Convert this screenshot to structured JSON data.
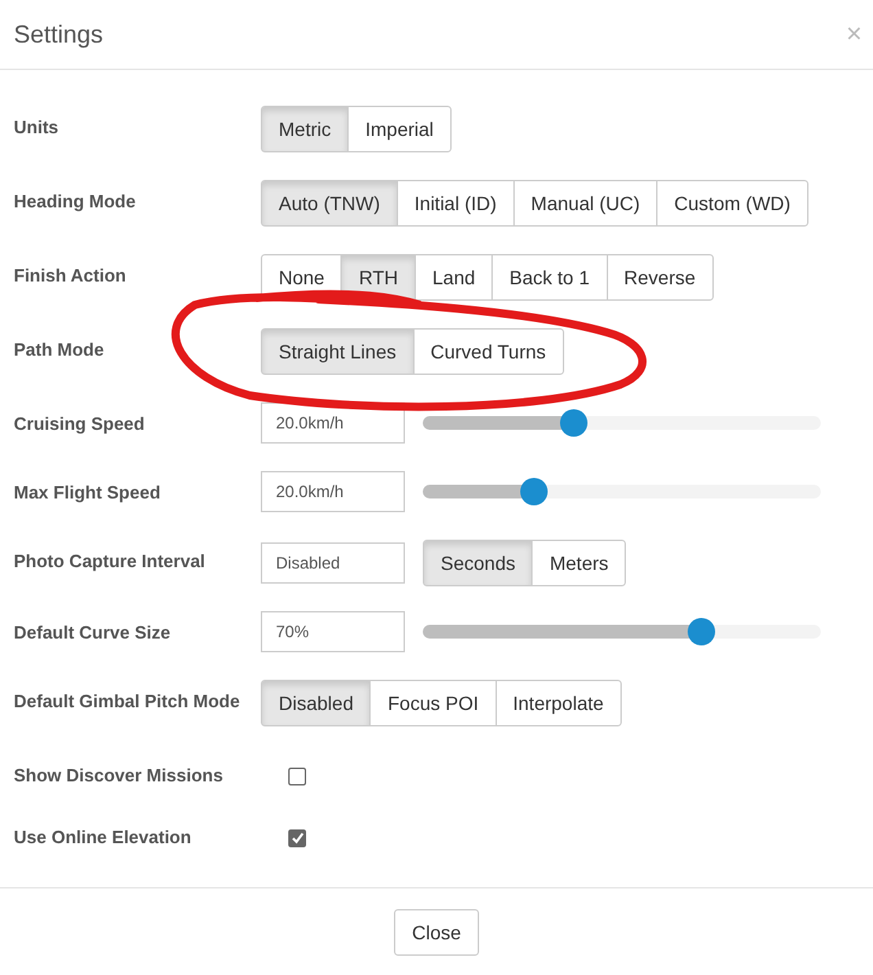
{
  "dialog": {
    "title": "Settings",
    "close_symbol": "×"
  },
  "rows": [
    {
      "kind": "segmented",
      "label": "Units",
      "options": [
        {
          "label": "Metric",
          "selected": true
        },
        {
          "label": "Imperial",
          "selected": false
        }
      ]
    },
    {
      "kind": "segmented",
      "label": "Heading Mode",
      "options": [
        {
          "label": "Auto (TNW)",
          "selected": true
        },
        {
          "label": "Initial (ID)",
          "selected": false
        },
        {
          "label": "Manual (UC)",
          "selected": false
        },
        {
          "label": "Custom (WD)",
          "selected": false
        }
      ]
    },
    {
      "kind": "segmented",
      "label": "Finish Action",
      "options": [
        {
          "label": "None",
          "selected": false
        },
        {
          "label": "RTH",
          "selected": true
        },
        {
          "label": "Land",
          "selected": false
        },
        {
          "label": "Back to 1",
          "selected": false
        },
        {
          "label": "Reverse",
          "selected": false
        }
      ]
    },
    {
      "kind": "segmented",
      "label": "Path Mode",
      "options": [
        {
          "label": "Straight Lines",
          "selected": true
        },
        {
          "label": "Curved Turns",
          "selected": false
        }
      ]
    },
    {
      "kind": "slider",
      "label": "Cruising Speed",
      "value": "20.0km/h",
      "level": 0.38
    },
    {
      "kind": "slider",
      "label": "Max Flight Speed",
      "value": "20.0km/h",
      "level": 0.28
    },
    {
      "kind": "input_segmented",
      "label": "Photo Capture Interval",
      "value": "Disabled",
      "options": [
        {
          "label": "Seconds",
          "selected": true
        },
        {
          "label": "Meters",
          "selected": false
        }
      ]
    },
    {
      "kind": "slider",
      "label": "Default Curve Size",
      "value": "70%",
      "level": 0.7
    },
    {
      "kind": "segmented",
      "label": "Default Gimbal Pitch Mode",
      "options": [
        {
          "label": "Disabled",
          "selected": true
        },
        {
          "label": "Focus POI",
          "selected": false
        },
        {
          "label": "Interpolate",
          "selected": false
        }
      ]
    },
    {
      "kind": "checkbox",
      "label": "Show Discover Missions",
      "checked": false
    },
    {
      "kind": "checkbox",
      "label": "Use Online Elevation",
      "checked": true
    }
  ],
  "footer": {
    "button": "Close"
  }
}
